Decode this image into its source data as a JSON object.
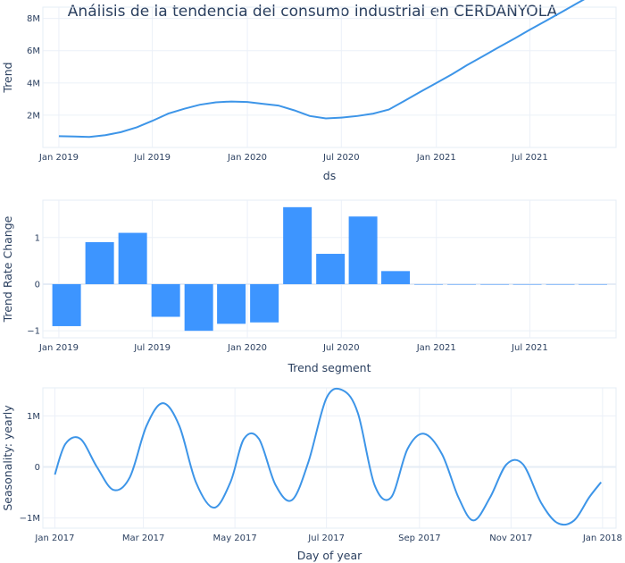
{
  "title": "Análisis de la tendencia del consumo industrial en CERDANYOLA",
  "colors": {
    "series": "#3d95e8",
    "bar": "#3d95ff",
    "text": "#2a3f5f"
  },
  "chart_data": [
    {
      "type": "line",
      "xlabel": "ds",
      "ylabel": "Trend",
      "x_ticks": [
        "Jan 2019",
        "Jul 2019",
        "Jan 2020",
        "Jul 2020",
        "Jan 2021",
        "Jul 2021"
      ],
      "y_ticks": [
        "2M",
        "4M",
        "6M",
        "8M"
      ],
      "ylim": [
        0,
        8700000
      ],
      "x": [
        "2019-01-01",
        "2019-02-01",
        "2019-03-01",
        "2019-04-01",
        "2019-05-01",
        "2019-06-01",
        "2019-07-01",
        "2019-08-01",
        "2019-09-01",
        "2019-10-01",
        "2019-11-01",
        "2019-12-01",
        "2020-01-01",
        "2020-02-01",
        "2020-03-01",
        "2020-04-01",
        "2020-05-01",
        "2020-06-01",
        "2020-07-01",
        "2020-08-01",
        "2020-09-01",
        "2020-10-01",
        "2020-11-01",
        "2020-12-01",
        "2021-01-01",
        "2021-02-01",
        "2021-03-01",
        "2021-04-01",
        "2021-05-01",
        "2021-06-01",
        "2021-07-01",
        "2021-08-01",
        "2021-09-01",
        "2021-10-01",
        "2021-11-01"
      ],
      "y": [
        700000,
        680000,
        650000,
        760000,
        950000,
        1250000,
        1650000,
        2100000,
        2400000,
        2650000,
        2800000,
        2850000,
        2820000,
        2700000,
        2600000,
        2300000,
        1950000,
        1800000,
        1850000,
        1950000,
        2100000,
        2350000,
        2900000,
        3450000,
        4000000,
        4550000,
        5100000,
        5650000,
        6200000,
        6750000,
        7300000,
        7850000,
        8400000,
        8950000,
        9500000
      ]
    },
    {
      "type": "bar",
      "xlabel": "Trend segment",
      "ylabel": "Trend Rate Change",
      "x_ticks": [
        "Jan 2019",
        "Jul 2019",
        "Jan 2020",
        "Jul 2020",
        "Jan 2021",
        "Jul 2021"
      ],
      "y_ticks": [
        "−1",
        "0",
        "1"
      ],
      "ylim": [
        -1.15,
        1.8
      ],
      "x": [
        "2019-01-16",
        "2019-03-21",
        "2019-05-24",
        "2019-07-27",
        "2019-09-29",
        "2019-12-01",
        "2020-02-03",
        "2020-04-07",
        "2020-06-10",
        "2020-08-12",
        "2020-10-14",
        "2020-12-17",
        "2021-02-19",
        "2021-04-24",
        "2021-06-26",
        "2021-08-29",
        "2021-10-31"
      ],
      "values": [
        -0.9,
        0.9,
        1.1,
        -0.7,
        -1.0,
        -0.85,
        -0.82,
        1.65,
        0.65,
        1.45,
        0.28,
        0,
        0,
        0,
        0,
        0,
        0
      ]
    },
    {
      "type": "line",
      "xlabel": "Day of year",
      "ylabel": "Seasonality: yearly",
      "x_ticks": [
        "Jan 2017",
        "Mar 2017",
        "May 2017",
        "Jul 2017",
        "Sep 2017",
        "Nov 2017",
        "Jan 2018"
      ],
      "y_ticks": [
        "−1M",
        "0",
        "1M"
      ],
      "ylim": [
        -1.2,
        1.55
      ],
      "x": [
        "2017-01-01",
        "2017-01-08",
        "2017-01-18",
        "2017-01-29",
        "2017-02-09",
        "2017-02-20",
        "2017-03-03",
        "2017-03-14",
        "2017-03-25",
        "2017-04-05",
        "2017-04-17",
        "2017-04-28",
        "2017-05-07",
        "2017-05-17",
        "2017-05-28",
        "2017-06-08",
        "2017-06-19",
        "2017-07-01",
        "2017-07-12",
        "2017-07-22",
        "2017-08-02",
        "2017-08-13",
        "2017-08-24",
        "2017-09-04",
        "2017-09-16",
        "2017-09-27",
        "2017-10-07",
        "2017-10-18",
        "2017-10-29",
        "2017-11-09",
        "2017-11-21",
        "2017-12-02",
        "2017-12-13",
        "2017-12-23",
        "2017-12-31"
      ],
      "y": [
        -0.15,
        0.45,
        0.55,
        0.0,
        -0.45,
        -0.2,
        0.8,
        1.25,
        0.8,
        -0.3,
        -0.8,
        -0.3,
        0.55,
        0.55,
        -0.35,
        -0.65,
        0.1,
        1.35,
        1.5,
        1.05,
        -0.35,
        -0.6,
        0.35,
        0.65,
        0.25,
        -0.6,
        -1.05,
        -0.6,
        0.05,
        0.05,
        -0.7,
        -1.1,
        -1.05,
        -0.6,
        -0.3
      ]
    }
  ]
}
